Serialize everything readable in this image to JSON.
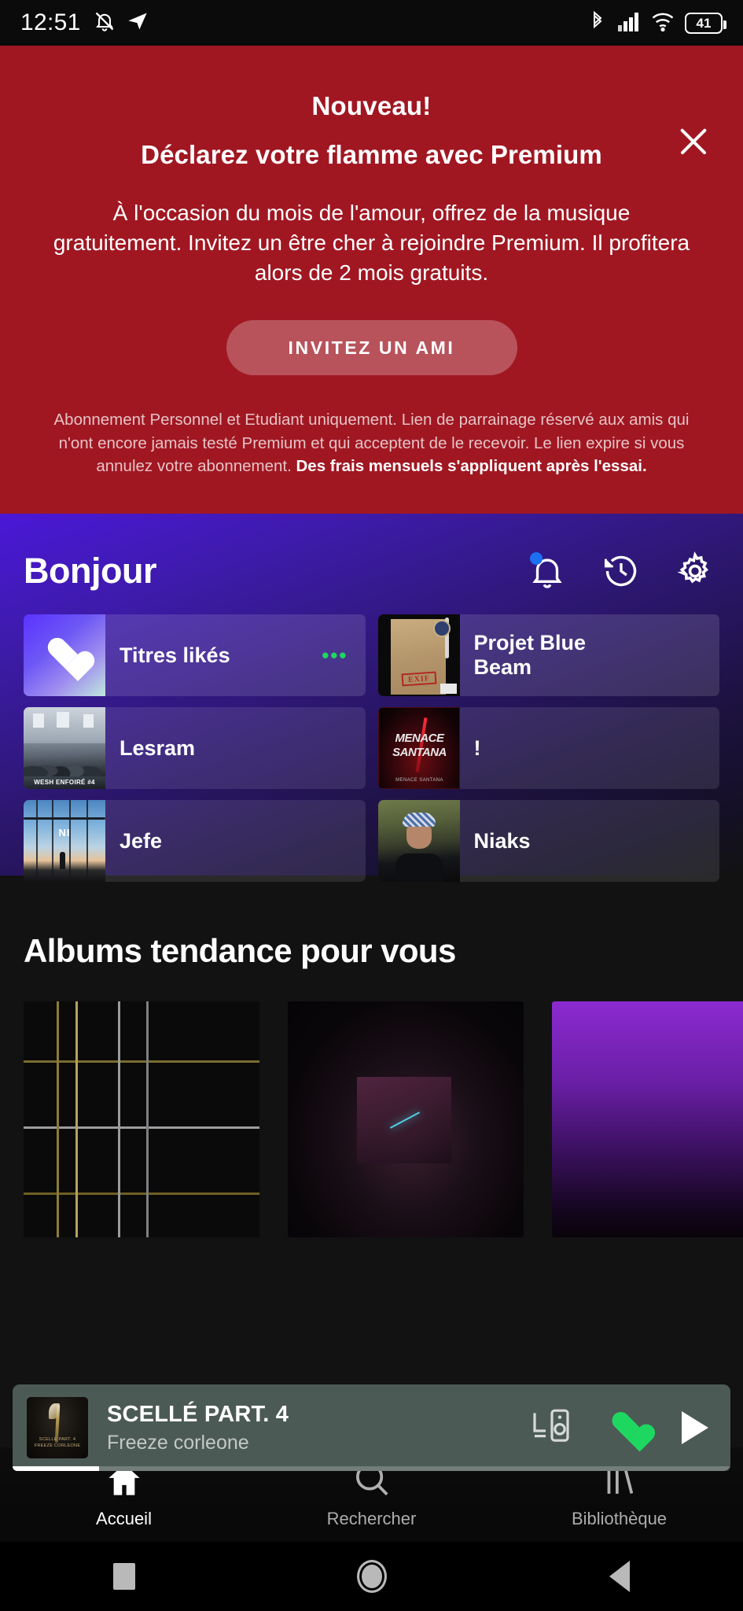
{
  "status_bar": {
    "time": "12:51",
    "battery_percent": "41",
    "icons": [
      "bell-muted-icon",
      "telegram-send-icon",
      "bluetooth-icon",
      "cellular-signal-icon",
      "wifi-icon",
      "battery-icon"
    ]
  },
  "promo_banner": {
    "eyebrow": "Nouveau!",
    "title": "Déclarez votre flamme avec Premium",
    "body": "À l'occasion du mois de l'amour, offrez de la musique gratuitement. Invitez un être cher à rejoindre Premium. Il profitera alors de 2 mois gratuits.",
    "cta_label": "INVITEZ UN AMI",
    "legal_regular": "Abonnement Personnel et Etudiant uniquement. Lien de parrainage réservé aux amis qui n'ont encore jamais testé Premium et qui acceptent de le recevoir. Le lien expire si vous annulez votre abonnement. ",
    "legal_bold": "Des frais mensuels s'appliquent après l'essai.",
    "close_icon": "close-icon",
    "background_color": "#a01722",
    "cta_background": "rgba(255,255,255,0.26)"
  },
  "header": {
    "greeting": "Bonjour",
    "icons": [
      {
        "name": "notifications-bell-icon",
        "has_badge": true,
        "badge_color": "#1d6ff2"
      },
      {
        "name": "recently-played-clock-icon",
        "has_badge": false
      },
      {
        "name": "settings-gear-icon",
        "has_badge": false
      }
    ]
  },
  "shortcuts": [
    {
      "label": "Titres likés",
      "art": "liked-songs-heart",
      "badge": "•••",
      "badge_color": "#1ed760"
    },
    {
      "label": "Projet Blue Beam",
      "art": "envelope-cover",
      "badge": "",
      "badge_color": ""
    },
    {
      "label": "Lesram",
      "art": "crowd-photo-cover",
      "badge": "",
      "badge_color": ""
    },
    {
      "label": "!",
      "art": "menace-santana-cover",
      "badge": "",
      "badge_color": ""
    },
    {
      "label": "Jefe",
      "art": "window-skyline-cover",
      "badge": "",
      "badge_color": ""
    },
    {
      "label": "Niaks",
      "art": "portrait-cap-cover",
      "badge": "",
      "badge_color": ""
    }
  ],
  "trending": {
    "section_title": "Albums tendance pour vous",
    "albums": [
      {
        "art": "circuit-board-cover"
      },
      {
        "art": "dark-abstract-cover"
      },
      {
        "art": "purple-gradient-cover"
      }
    ]
  },
  "now_playing": {
    "track_title": "SCELLÉ PART. 4",
    "artist": "Freeze corleone",
    "artwork": "feather-candle-cover",
    "connect_icon": "connect-to-device-icon",
    "like_icon": "heart-filled-icon",
    "like_color": "#1ed760",
    "play_icon": "play-icon",
    "progress_percent": 12,
    "background_color": "#4c5a56"
  },
  "bottom_nav": [
    {
      "label": "Accueil",
      "icon": "home-icon",
      "active": true
    },
    {
      "label": "Rechercher",
      "icon": "search-icon",
      "active": false
    },
    {
      "label": "Bibliothèque",
      "icon": "library-icon",
      "active": false
    }
  ],
  "android_nav": [
    {
      "name": "recents-button",
      "icon": "square-icon"
    },
    {
      "name": "home-button",
      "icon": "circle-icon"
    },
    {
      "name": "back-button",
      "icon": "triangle-left-icon"
    }
  ]
}
